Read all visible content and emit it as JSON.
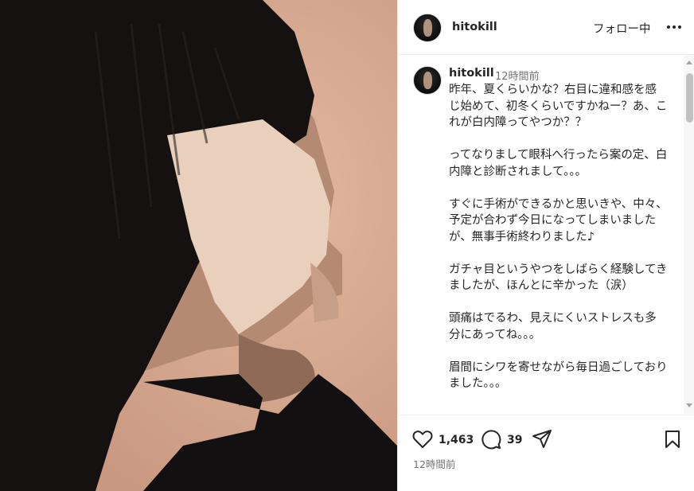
{
  "post": {
    "username": "hitokill",
    "follow_label": "フォロー中",
    "more_icon": "more-horizontal-icon"
  },
  "comment": {
    "username": "hitokill",
    "time": "12時間前",
    "caption": "昨年、夏くらいかな？右目に違和感を感じ始めて、初冬くらいですかねー？あ、これが白内障ってやつか？？\n\nってなりまして眼科へ行ったら案の定、白内障と診断されまして。。。\n\nすぐに手術ができるかと思いきや、中々、予定が合わず今日になってしまいましたが、無事手術終わりました♪\n\nガチャ目というやつをしばらく経験してきましたが、ほんとに辛かった（涙）\n\n頭痛はでるわ、見えにくいストレスも多分にあってね。。。\n\n眉間にシワを寄せながら毎日過ごしておりました。。。"
  },
  "actions": {
    "likes": "1,463",
    "comments": "39",
    "time": "12時間前",
    "icons": [
      "heart-icon",
      "comment-icon",
      "share-icon",
      "bookmark-icon"
    ]
  }
}
